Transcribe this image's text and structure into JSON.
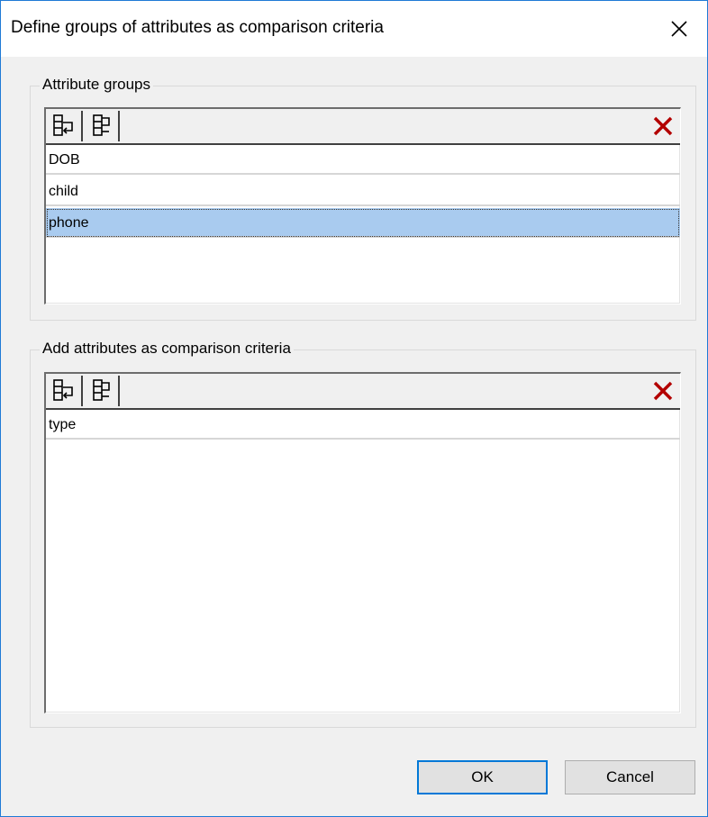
{
  "dialog": {
    "title": "Define groups of attributes as comparison criteria",
    "close_icon": "close-icon"
  },
  "attribute_groups": {
    "legend": "Attribute groups",
    "toolbar": {
      "insert_icon": "insert-row-icon",
      "append_icon": "append-row-icon",
      "delete_icon": "delete-icon",
      "delete_color": "#b30000"
    },
    "items": [
      "DOB",
      "child",
      "phone"
    ],
    "selected_index": 2
  },
  "comparison_attributes": {
    "legend": "Add attributes as comparison criteria",
    "toolbar": {
      "insert_icon": "insert-row-icon",
      "append_icon": "append-row-icon",
      "delete_icon": "delete-icon",
      "delete_color": "#b30000"
    },
    "items": [
      "type"
    ]
  },
  "buttons": {
    "ok": "OK",
    "cancel": "Cancel"
  },
  "colors": {
    "selection": "#a9cbef",
    "accent": "#0078d7"
  }
}
